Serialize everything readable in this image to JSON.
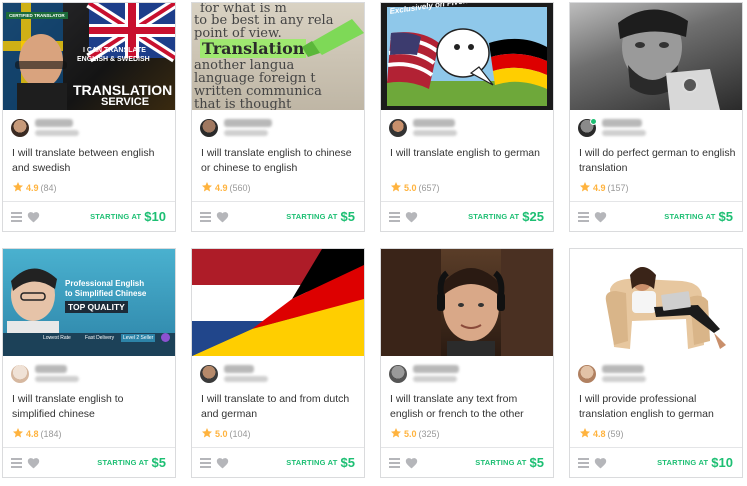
{
  "footer_label": "STARTING AT",
  "gigs": [
    {
      "title": "I will translate between english and swedish",
      "rating": "4.9",
      "reviews": "(84)",
      "price": "$10",
      "thumb_line1": "I CAN TRANSLATE",
      "thumb_line2": "ENGLISH & SWEDISH",
      "thumb_line3": "TRANSLATION",
      "thumb_line4": "SERVICE",
      "thumb_badge": "CERTIFIED TRANSLATOR"
    },
    {
      "title": "I will translate english to chinese or chinese to english",
      "rating": "4.9",
      "reviews": "(560)",
      "price": "$5",
      "thumb_line1": "for what is m",
      "thumb_line2": "to be best in any rela",
      "thumb_line3": "point of view.",
      "thumb_line4": "Translation",
      "thumb_line5": "another langua",
      "thumb_line6": "language foreign t",
      "thumb_line7": "written communica",
      "thumb_line8": "that is thought"
    },
    {
      "title": "I will translate english to german",
      "rating": "5.0",
      "reviews": "(657)",
      "price": "$25",
      "thumb_text": "Exclusively on Fiverr!"
    },
    {
      "title": "I will do perfect german to english translation",
      "rating": "4.9",
      "reviews": "(157)",
      "price": "$5"
    },
    {
      "title": "I will translate english to simplified chinese",
      "rating": "4.8",
      "reviews": "(184)",
      "price": "$5",
      "thumb_line1": "Professional English",
      "thumb_line2": "to Simplified Chinese",
      "thumb_line3": "TOP QUALITY",
      "thumb_tag1": "Lowest Rate",
      "thumb_tag2": "Fast Delivery",
      "thumb_tag3": "Level 2 Seller"
    },
    {
      "title": "I will translate to and from dutch and german",
      "rating": "5.0",
      "reviews": "(104)",
      "price": "$5"
    },
    {
      "title": "I will translate any text from english or french to the other",
      "rating": "5.0",
      "reviews": "(325)",
      "price": "$5"
    },
    {
      "title": "I will provide professional translation english to german",
      "rating": "4.8",
      "reviews": "(59)",
      "price": "$10"
    }
  ],
  "colors": {
    "green": "#1dbf73",
    "star": "#ffb33e",
    "border": "#dadbdd"
  }
}
